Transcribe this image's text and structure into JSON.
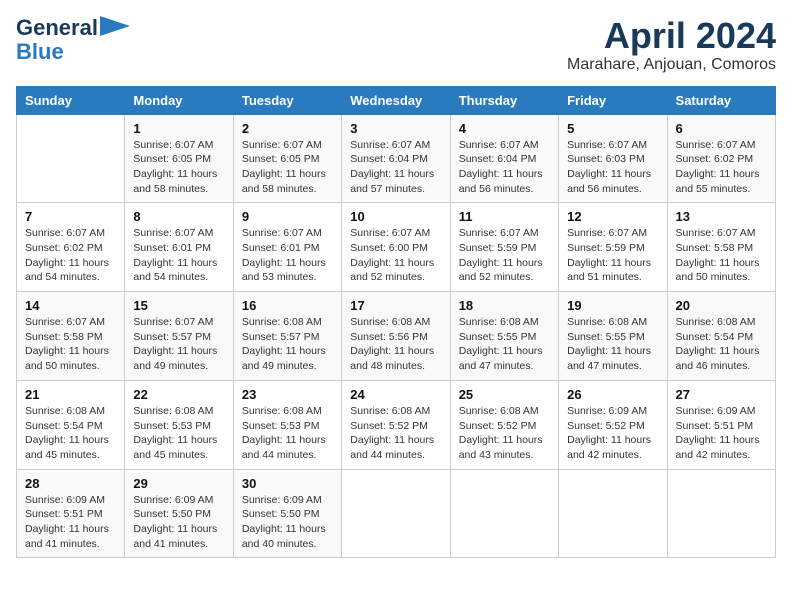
{
  "header": {
    "logo_line1": "General",
    "logo_line2": "Blue",
    "month": "April 2024",
    "location": "Marahare, Anjouan, Comoros"
  },
  "weekdays": [
    "Sunday",
    "Monday",
    "Tuesday",
    "Wednesday",
    "Thursday",
    "Friday",
    "Saturday"
  ],
  "weeks": [
    [
      {
        "day": "",
        "info": ""
      },
      {
        "day": "1",
        "info": "Sunrise: 6:07 AM\nSunset: 6:05 PM\nDaylight: 11 hours\nand 58 minutes."
      },
      {
        "day": "2",
        "info": "Sunrise: 6:07 AM\nSunset: 6:05 PM\nDaylight: 11 hours\nand 58 minutes."
      },
      {
        "day": "3",
        "info": "Sunrise: 6:07 AM\nSunset: 6:04 PM\nDaylight: 11 hours\nand 57 minutes."
      },
      {
        "day": "4",
        "info": "Sunrise: 6:07 AM\nSunset: 6:04 PM\nDaylight: 11 hours\nand 56 minutes."
      },
      {
        "day": "5",
        "info": "Sunrise: 6:07 AM\nSunset: 6:03 PM\nDaylight: 11 hours\nand 56 minutes."
      },
      {
        "day": "6",
        "info": "Sunrise: 6:07 AM\nSunset: 6:02 PM\nDaylight: 11 hours\nand 55 minutes."
      }
    ],
    [
      {
        "day": "7",
        "info": "Sunrise: 6:07 AM\nSunset: 6:02 PM\nDaylight: 11 hours\nand 54 minutes."
      },
      {
        "day": "8",
        "info": "Sunrise: 6:07 AM\nSunset: 6:01 PM\nDaylight: 11 hours\nand 54 minutes."
      },
      {
        "day": "9",
        "info": "Sunrise: 6:07 AM\nSunset: 6:01 PM\nDaylight: 11 hours\nand 53 minutes."
      },
      {
        "day": "10",
        "info": "Sunrise: 6:07 AM\nSunset: 6:00 PM\nDaylight: 11 hours\nand 52 minutes."
      },
      {
        "day": "11",
        "info": "Sunrise: 6:07 AM\nSunset: 5:59 PM\nDaylight: 11 hours\nand 52 minutes."
      },
      {
        "day": "12",
        "info": "Sunrise: 6:07 AM\nSunset: 5:59 PM\nDaylight: 11 hours\nand 51 minutes."
      },
      {
        "day": "13",
        "info": "Sunrise: 6:07 AM\nSunset: 5:58 PM\nDaylight: 11 hours\nand 50 minutes."
      }
    ],
    [
      {
        "day": "14",
        "info": "Sunrise: 6:07 AM\nSunset: 5:58 PM\nDaylight: 11 hours\nand 50 minutes."
      },
      {
        "day": "15",
        "info": "Sunrise: 6:07 AM\nSunset: 5:57 PM\nDaylight: 11 hours\nand 49 minutes."
      },
      {
        "day": "16",
        "info": "Sunrise: 6:08 AM\nSunset: 5:57 PM\nDaylight: 11 hours\nand 49 minutes."
      },
      {
        "day": "17",
        "info": "Sunrise: 6:08 AM\nSunset: 5:56 PM\nDaylight: 11 hours\nand 48 minutes."
      },
      {
        "day": "18",
        "info": "Sunrise: 6:08 AM\nSunset: 5:55 PM\nDaylight: 11 hours\nand 47 minutes."
      },
      {
        "day": "19",
        "info": "Sunrise: 6:08 AM\nSunset: 5:55 PM\nDaylight: 11 hours\nand 47 minutes."
      },
      {
        "day": "20",
        "info": "Sunrise: 6:08 AM\nSunset: 5:54 PM\nDaylight: 11 hours\nand 46 minutes."
      }
    ],
    [
      {
        "day": "21",
        "info": "Sunrise: 6:08 AM\nSunset: 5:54 PM\nDaylight: 11 hours\nand 45 minutes."
      },
      {
        "day": "22",
        "info": "Sunrise: 6:08 AM\nSunset: 5:53 PM\nDaylight: 11 hours\nand 45 minutes."
      },
      {
        "day": "23",
        "info": "Sunrise: 6:08 AM\nSunset: 5:53 PM\nDaylight: 11 hours\nand 44 minutes."
      },
      {
        "day": "24",
        "info": "Sunrise: 6:08 AM\nSunset: 5:52 PM\nDaylight: 11 hours\nand 44 minutes."
      },
      {
        "day": "25",
        "info": "Sunrise: 6:08 AM\nSunset: 5:52 PM\nDaylight: 11 hours\nand 43 minutes."
      },
      {
        "day": "26",
        "info": "Sunrise: 6:09 AM\nSunset: 5:52 PM\nDaylight: 11 hours\nand 42 minutes."
      },
      {
        "day": "27",
        "info": "Sunrise: 6:09 AM\nSunset: 5:51 PM\nDaylight: 11 hours\nand 42 minutes."
      }
    ],
    [
      {
        "day": "28",
        "info": "Sunrise: 6:09 AM\nSunset: 5:51 PM\nDaylight: 11 hours\nand 41 minutes."
      },
      {
        "day": "29",
        "info": "Sunrise: 6:09 AM\nSunset: 5:50 PM\nDaylight: 11 hours\nand 41 minutes."
      },
      {
        "day": "30",
        "info": "Sunrise: 6:09 AM\nSunset: 5:50 PM\nDaylight: 11 hours\nand 40 minutes."
      },
      {
        "day": "",
        "info": ""
      },
      {
        "day": "",
        "info": ""
      },
      {
        "day": "",
        "info": ""
      },
      {
        "day": "",
        "info": ""
      }
    ]
  ]
}
